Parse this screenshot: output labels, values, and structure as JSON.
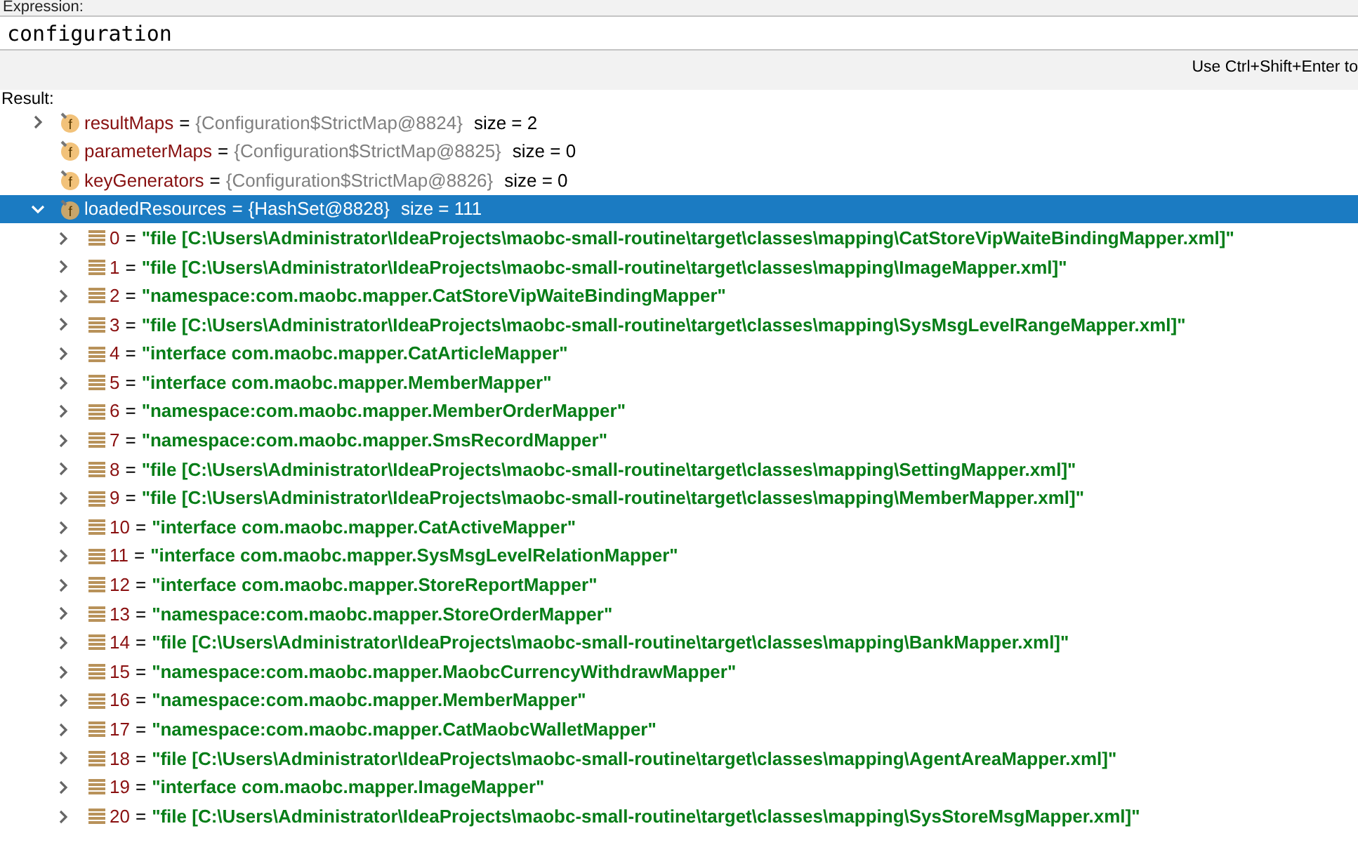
{
  "expression": {
    "label": "Expression:",
    "value": "configuration"
  },
  "hint": "Use Ctrl+Shift+Enter to",
  "result_label": "Result:",
  "tree": [
    {
      "icon_text": "f",
      "name": "resultMaps",
      "equals": "=",
      "value": "{Configuration$StrictMap@8824}",
      "size": "size = 2",
      "expanded": false,
      "selected": false
    },
    {
      "icon_text": "f",
      "name": "parameterMaps",
      "equals": "=",
      "value": "{Configuration$StrictMap@8825}",
      "size": "size = 0",
      "selected": false
    },
    {
      "icon_text": "f",
      "name": "keyGenerators",
      "equals": "=",
      "value": "{Configuration$StrictMap@8826}",
      "size": "size = 0",
      "selected": false
    },
    {
      "icon_text": "f",
      "name": "loadedResources",
      "equals": "=",
      "value": "{HashSet@8828}",
      "size": "size = 111",
      "expanded": true,
      "selected": true,
      "children": [
        {
          "index": "0",
          "equals": "=",
          "value": "\"file [C:\\Users\\Administrator\\IdeaProjects\\maobc-small-routine\\target\\classes\\mapping\\CatStoreVipWaiteBindingMapper.xml]\""
        },
        {
          "index": "1",
          "equals": "=",
          "value": "\"file [C:\\Users\\Administrator\\IdeaProjects\\maobc-small-routine\\target\\classes\\mapping\\ImageMapper.xml]\""
        },
        {
          "index": "2",
          "equals": "=",
          "value": "\"namespace:com.maobc.mapper.CatStoreVipWaiteBindingMapper\""
        },
        {
          "index": "3",
          "equals": "=",
          "value": "\"file [C:\\Users\\Administrator\\IdeaProjects\\maobc-small-routine\\target\\classes\\mapping\\SysMsgLevelRangeMapper.xml]\""
        },
        {
          "index": "4",
          "equals": "=",
          "value": "\"interface com.maobc.mapper.CatArticleMapper\""
        },
        {
          "index": "5",
          "equals": "=",
          "value": "\"interface com.maobc.mapper.MemberMapper\""
        },
        {
          "index": "6",
          "equals": "=",
          "value": "\"namespace:com.maobc.mapper.MemberOrderMapper\""
        },
        {
          "index": "7",
          "equals": "=",
          "value": "\"namespace:com.maobc.mapper.SmsRecordMapper\""
        },
        {
          "index": "8",
          "equals": "=",
          "value": "\"file [C:\\Users\\Administrator\\IdeaProjects\\maobc-small-routine\\target\\classes\\mapping\\SettingMapper.xml]\""
        },
        {
          "index": "9",
          "equals": "=",
          "value": "\"file [C:\\Users\\Administrator\\IdeaProjects\\maobc-small-routine\\target\\classes\\mapping\\MemberMapper.xml]\""
        },
        {
          "index": "10",
          "equals": "=",
          "value": "\"interface com.maobc.mapper.CatActiveMapper\""
        },
        {
          "index": "11",
          "equals": "=",
          "value": "\"interface com.maobc.mapper.SysMsgLevelRelationMapper\""
        },
        {
          "index": "12",
          "equals": "=",
          "value": "\"interface com.maobc.mapper.StoreReportMapper\""
        },
        {
          "index": "13",
          "equals": "=",
          "value": "\"namespace:com.maobc.mapper.StoreOrderMapper\""
        },
        {
          "index": "14",
          "equals": "=",
          "value": "\"file [C:\\Users\\Administrator\\IdeaProjects\\maobc-small-routine\\target\\classes\\mapping\\BankMapper.xml]\""
        },
        {
          "index": "15",
          "equals": "=",
          "value": "\"namespace:com.maobc.mapper.MaobcCurrencyWithdrawMapper\""
        },
        {
          "index": "16",
          "equals": "=",
          "value": "\"namespace:com.maobc.mapper.MemberMapper\""
        },
        {
          "index": "17",
          "equals": "=",
          "value": "\"namespace:com.maobc.mapper.CatMaobcWalletMapper\""
        },
        {
          "index": "18",
          "equals": "=",
          "value": "\"file [C:\\Users\\Administrator\\IdeaProjects\\maobc-small-routine\\target\\classes\\mapping\\AgentAreaMapper.xml]\""
        },
        {
          "index": "19",
          "equals": "=",
          "value": "\"interface com.maobc.mapper.ImageMapper\""
        },
        {
          "index": "20",
          "equals": "=",
          "value": "\"file [C:\\Users\\Administrator\\IdeaProjects\\maobc-small-routine\\target\\classes\\mapping\\SysStoreMsgMapper.xml]\""
        }
      ]
    }
  ]
}
